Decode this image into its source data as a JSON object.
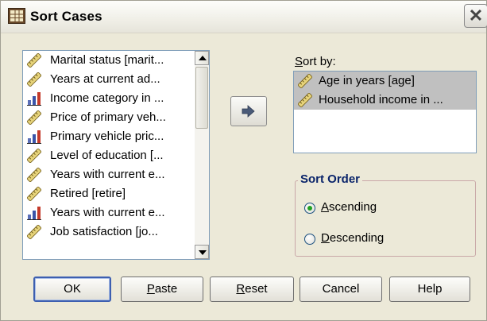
{
  "window": {
    "title": "Sort Cases",
    "app_icon": "spss-data-icon",
    "close_icon": "close-icon"
  },
  "variables": [
    {
      "label": "Marital status [marit...",
      "icon": "ruler-scale-icon"
    },
    {
      "label": "Years at current ad...",
      "icon": "ruler-scale-icon"
    },
    {
      "label": "Income category in ...",
      "icon": "ordinal-bars-icon"
    },
    {
      "label": "Price of primary veh...",
      "icon": "ruler-scale-icon"
    },
    {
      "label": "Primary vehicle pric...",
      "icon": "ordinal-bars-icon"
    },
    {
      "label": "Level of education [...",
      "icon": "ruler-scale-icon"
    },
    {
      "label": "Years with current e...",
      "icon": "ruler-scale-icon"
    },
    {
      "label": "Retired [retire]",
      "icon": "ruler-scale-icon"
    },
    {
      "label": "Years with current e...",
      "icon": "ordinal-bars-icon"
    },
    {
      "label": "Job satisfaction [jo...",
      "icon": "ruler-scale-icon"
    }
  ],
  "move_button_icon": "right-arrow-icon",
  "sort_by": {
    "label_prefix": "S",
    "label_rest": "ort by:",
    "items": [
      {
        "label": "Age in years [age]",
        "icon": "ruler-scale-icon"
      },
      {
        "label": "Household income in ...",
        "icon": "ruler-scale-icon"
      }
    ]
  },
  "sort_order": {
    "title": "Sort Order",
    "options": [
      {
        "mn": "A",
        "rest": "scending",
        "selected": true
      },
      {
        "mn": "D",
        "rest": "escending",
        "selected": false
      }
    ]
  },
  "buttons": {
    "ok": {
      "label": "OK"
    },
    "paste": {
      "mn": "P",
      "rest": "aste"
    },
    "reset": {
      "mn": "R",
      "rest": "eset"
    },
    "cancel": {
      "label": "Cancel"
    },
    "help": {
      "label": "Help"
    }
  },
  "colors": {
    "selection": "#c0c0c0",
    "group_border": "#c9a8a8",
    "group_title": "#0a246a",
    "dialog_bg": "#ece9d8"
  }
}
